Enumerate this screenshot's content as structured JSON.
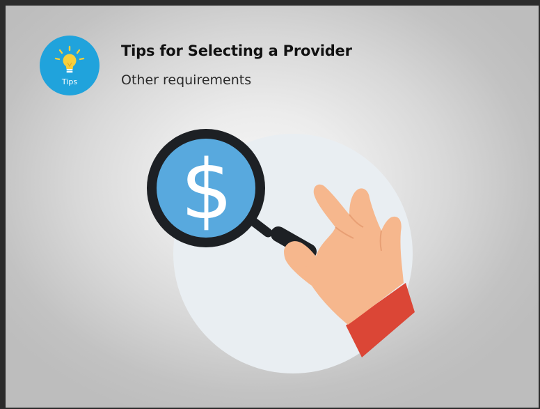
{
  "header": {
    "title": "Tips for Selecting a Provider",
    "subtitle": "Other requirements"
  },
  "badge": {
    "label": "Tips",
    "icon": "lightbulb-icon"
  },
  "illustration": {
    "icon": "magnifier-dollar-hand-illustration",
    "lens_symbol": "$"
  },
  "colors": {
    "badge_blue": "#20a3dc",
    "bulb_yellow": "#f7cf3c",
    "lens_blue": "#58a9de",
    "lens_rim": "#1d2024",
    "circle_fill": "#e9eef2",
    "skin": "#f6b78d",
    "sleeve_red": "#db4636"
  }
}
